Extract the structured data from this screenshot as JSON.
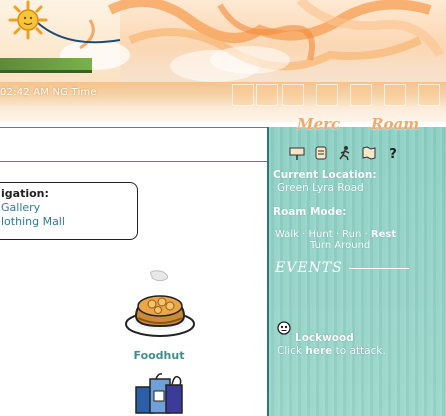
{
  "header": {
    "time_text": "02:42 AM NG Time"
  },
  "main": {
    "nav_box": {
      "title": "igation:",
      "links": [
        "Gallery",
        "lothing Mall"
      ]
    },
    "locations": [
      {
        "label": "Foodhut",
        "icon": "pancake-plate-icon"
      },
      {
        "label": "",
        "icon": "shopping-bag-icon"
      }
    ]
  },
  "sidebar": {
    "tabs": [
      "Merc",
      "Roam"
    ],
    "icons": [
      "sign-icon",
      "scroll-icon",
      "running-man-icon",
      "map-icon",
      "question-icon"
    ],
    "current_location_label": "Current Location:",
    "current_location_value": "Green Lyra Road",
    "roam_mode_label": "Roam Mode:",
    "roam_modes": [
      "Walk",
      "Hunt",
      "Run",
      "Rest"
    ],
    "roam_mode_active": "Rest",
    "turn_around": "Turn Around",
    "events_title": "EVENTS",
    "event": {
      "name": "Lockwood",
      "prefix": "Click",
      "link": "here",
      "suffix": "to attack."
    }
  },
  "colors": {
    "accent_teal": "#3f8f8f",
    "sidebar_bg": "#8ccfc3",
    "tab_orange": "#f3a868",
    "link_blue": "#2a7c96"
  }
}
